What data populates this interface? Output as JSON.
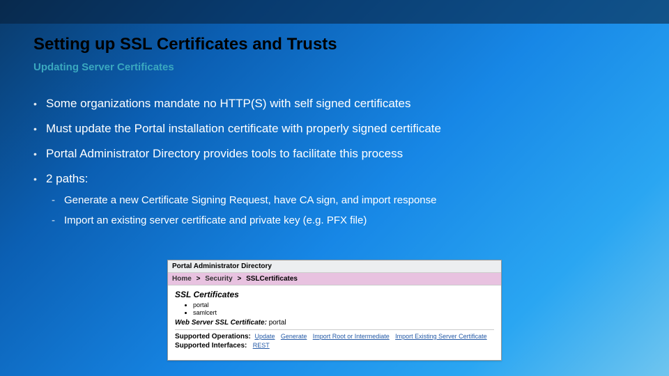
{
  "slide": {
    "title": "Setting up SSL Certificates and Trusts",
    "subtitle": "Updating Server Certificates",
    "bullets": {
      "b1": "Some organizations mandate no HTTP(S) with self signed certificates",
      "b2": "Must update the Portal installation certificate with properly signed certificate",
      "b3": "Portal Administrator Directory provides tools to facilitate this process",
      "b4": "2 paths:",
      "sub1": "Generate a new Certificate Signing Request, have CA sign, and import response",
      "sub2": "Import an existing server certificate and private key (e.g. PFX file)"
    }
  },
  "portal": {
    "windowTitle": "Portal Administrator Directory",
    "crumbHome": "Home",
    "crumbSecurity": "Security",
    "crumbCurrent": "SSLCertificates",
    "sep": ">",
    "sectionHeading": "SSL Certificates",
    "list": {
      "item1": "portal",
      "item2": "samlcert"
    },
    "webServerLabel": "Web Server SSL Certificate:",
    "webServerValue": "portal",
    "supportedOpsLabel": "Supported Operations:",
    "op1": "Update",
    "op2": "Generate",
    "op3": "Import Root or Intermediate",
    "op4": "Import Existing Server Certificate",
    "supportedIfaceLabel": "Supported Interfaces:",
    "iface1": "REST"
  }
}
